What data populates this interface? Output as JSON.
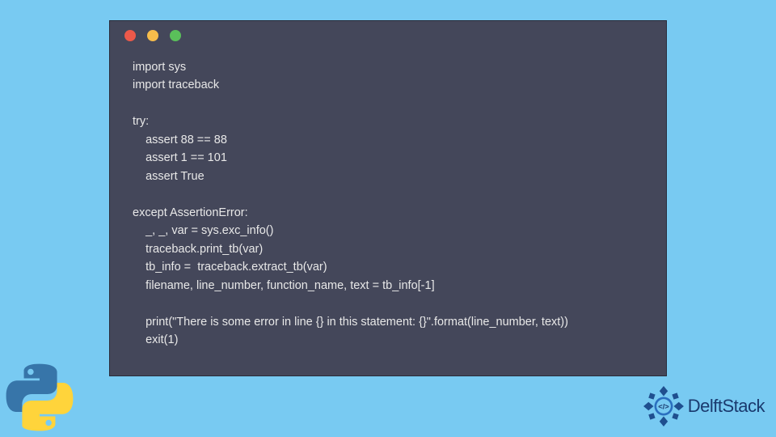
{
  "window": {
    "dots": [
      "red",
      "yellow",
      "green"
    ]
  },
  "code": {
    "l1": "import sys",
    "l2": "import traceback",
    "l3": "",
    "l4": "try:",
    "l5": "    assert 88 == 88",
    "l6": "    assert 1 == 101",
    "l7": "    assert True",
    "l8": "",
    "l9": "except AssertionError:",
    "l10": "    _, _, var = sys.exc_info()",
    "l11": "    traceback.print_tb(var)",
    "l12": "    tb_info =  traceback.extract_tb(var)",
    "l13": "    filename, line_number, function_name, text = tb_info[-1]",
    "l14": "",
    "l15": "    print(\"There is some error in line {} in this statement: {}\".format(line_number, text))",
    "l16": "    exit(1)"
  },
  "logo": {
    "brand": "DelftStack"
  }
}
